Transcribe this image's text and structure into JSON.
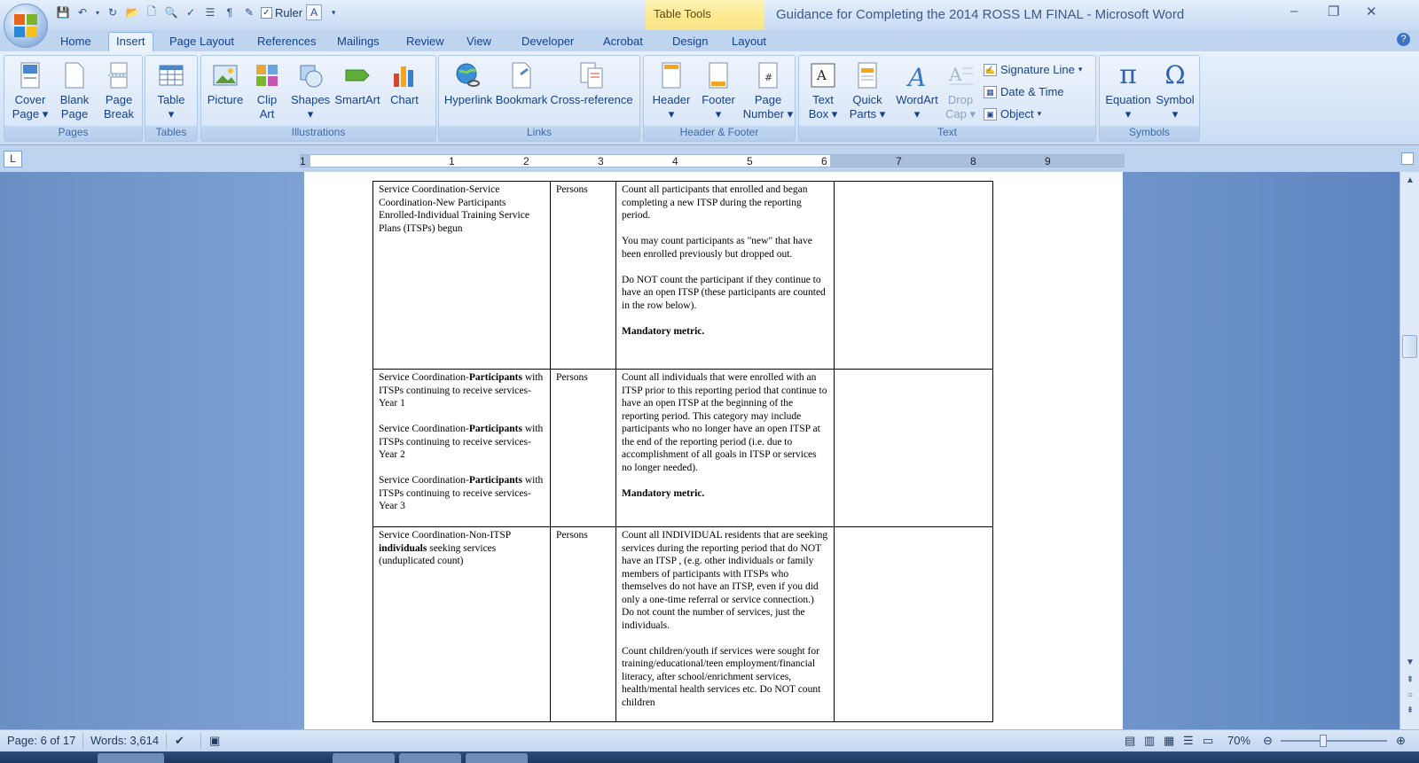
{
  "window": {
    "title": "Guidance for Completing the 2014 ROSS LM FINAL - Microsoft Word",
    "context_tab_group": "Table Tools",
    "controls": [
      "–",
      "❐",
      "✕"
    ]
  },
  "quick_access": {
    "ruler_label": "Ruler",
    "ruler_checked": "✓"
  },
  "tabs": [
    "Home",
    "Insert",
    "Page Layout",
    "References",
    "Mailings",
    "Review",
    "View",
    "Developer",
    "Acrobat",
    "Design",
    "Layout"
  ],
  "active_tab": "Insert",
  "ribbon": {
    "pages": {
      "label": "Pages",
      "cover_l1": "Cover",
      "cover_l2": "Page",
      "blank_l1": "Blank",
      "blank_l2": "Page",
      "break_l1": "Page",
      "break_l2": "Break"
    },
    "tables": {
      "label": "Tables",
      "table": "Table"
    },
    "illustrations": {
      "label": "Illustrations",
      "picture": "Picture",
      "clip_l1": "Clip",
      "clip_l2": "Art",
      "shapes": "Shapes",
      "smartart": "SmartArt",
      "chart": "Chart"
    },
    "links": {
      "label": "Links",
      "hyperlink": "Hyperlink",
      "bookmark": "Bookmark",
      "crossref": "Cross-reference"
    },
    "header_footer": {
      "label": "Header & Footer",
      "header": "Header",
      "footer": "Footer",
      "pagenum_l1": "Page",
      "pagenum_l2": "Number"
    },
    "text": {
      "label": "Text",
      "textbox_l1": "Text",
      "textbox_l2": "Box",
      "quick_l1": "Quick",
      "quick_l2": "Parts",
      "wordart": "WordArt",
      "drop_l1": "Drop",
      "drop_l2": "Cap",
      "signature": "Signature Line",
      "datetime": "Date & Time",
      "object": "Object"
    },
    "symbols": {
      "label": "Symbols",
      "equation": "Equation",
      "symbol": "Symbol"
    }
  },
  "ruler": {
    "numbers": [
      "1",
      "1",
      "2",
      "3",
      "4",
      "5",
      "6",
      "7",
      "8",
      "9"
    ]
  },
  "document": {
    "rows": [
      {
        "col1": [
          {
            "t": "Service Coordination-Service Coordination-New Participants Enrolled-Individual Training Service Plans (ITSPs) begun",
            "b": ""
          }
        ],
        "unit": "Persons",
        "desc": [
          "Count all participants that enrolled and began completing a new ITSP during the reporting period.",
          "You may count participants as \"new\" that have been enrolled previously but dropped out.",
          "Do NOT count the participant if they continue to have an open ITSP (these participants are counted in the row below)."
        ],
        "bold_note": "Mandatory metric."
      },
      {
        "col1": [
          {
            "pre": "Service Coordination-",
            "b": "Participants",
            "post": " with ITSPs continuing to receive services-Year 1"
          },
          {
            "pre": "Service Coordination-",
            "b": "Participants",
            "post": " with ITSPs continuing to receive services-Year 2"
          },
          {
            "pre": "Service Coordination-",
            "b": "Participants",
            "post": " with ITSPs continuing to receive services-Year 3"
          }
        ],
        "unit": "Persons",
        "desc": [
          "Count all individuals that were enrolled with an ITSP prior to this reporting period that continue to have an open ITSP at the beginning of the reporting period.  This category may include participants who no longer have an open ITSP at the end of the reporting period (i.e. due to accomplishment of all goals in ITSP or services no longer needed)."
        ],
        "bold_note": "Mandatory metric."
      },
      {
        "col1": [
          {
            "pre": "Service Coordination-Non-ITSP ",
            "b": "individuals",
            "post": " seeking services (unduplicated count)"
          }
        ],
        "unit": "Persons",
        "desc": [
          "Count all INDIVIDUAL residents that are seeking services during the reporting period that do NOT have an ITSP , (e.g. other individuals or family members of participants with ITSPs who themselves do not have an ITSP, even if you did only a one-time referral or service connection.)  Do not count the number of services, just the individuals.",
          "Count children/youth if services were sought for training/educational/teen employment/financial literacy, after school/enrichment services, health/mental health services etc.  Do NOT count children"
        ],
        "bold_note": ""
      }
    ]
  },
  "status": {
    "page": "Page: 6 of 17",
    "words": "Words: 3,614",
    "zoom": "70%"
  },
  "colors": {
    "accent": "#15428b",
    "workspace": "#7fa3d6",
    "context_tab": "#fde98c"
  }
}
